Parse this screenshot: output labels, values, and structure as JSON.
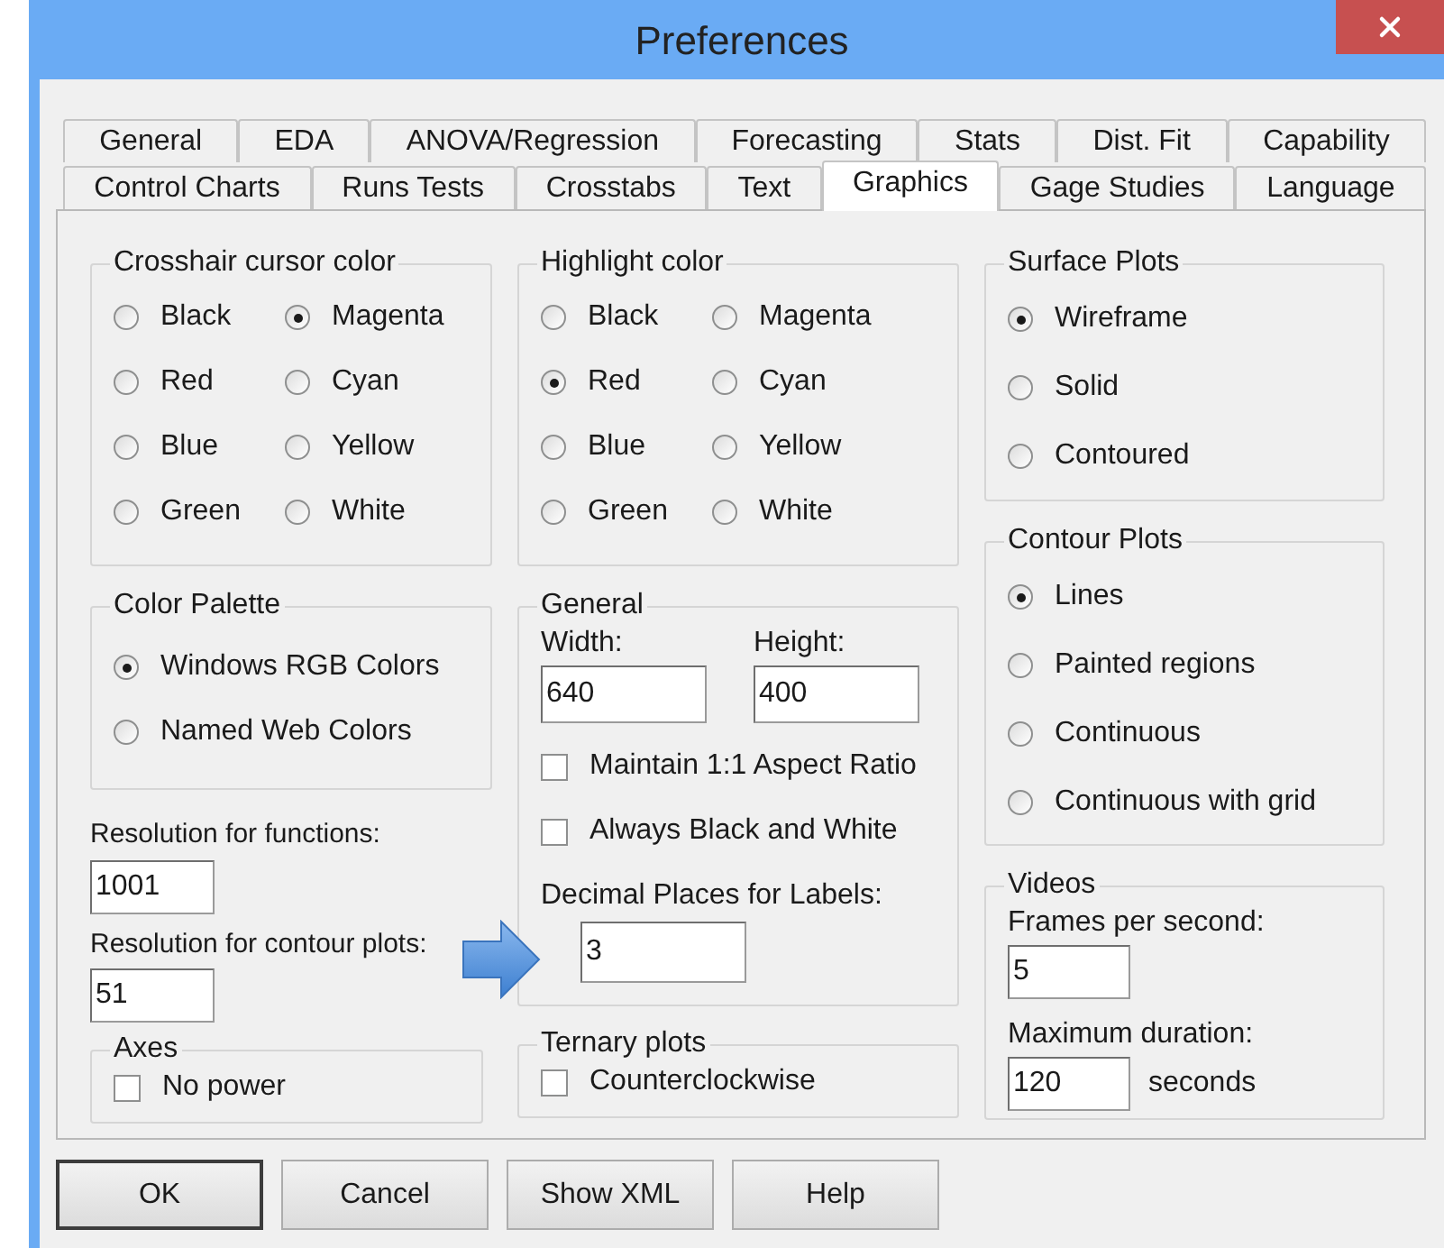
{
  "window": {
    "title": "Preferences"
  },
  "tab_rows": [
    {
      "tabs": [
        {
          "label": "General",
          "selected": false
        },
        {
          "label": "EDA",
          "selected": false
        },
        {
          "label": "ANOVA/Regression",
          "selected": false
        },
        {
          "label": "Forecasting",
          "selected": false
        },
        {
          "label": "Stats",
          "selected": false
        },
        {
          "label": "Dist. Fit",
          "selected": false
        },
        {
          "label": "Capability",
          "selected": false
        }
      ]
    },
    {
      "tabs": [
        {
          "label": "Control Charts",
          "selected": false
        },
        {
          "label": "Runs Tests",
          "selected": false
        },
        {
          "label": "Crosstabs",
          "selected": false
        },
        {
          "label": "Text",
          "selected": false
        },
        {
          "label": "Graphics",
          "selected": true
        },
        {
          "label": "Gage Studies",
          "selected": false
        },
        {
          "label": "Language",
          "selected": false
        }
      ]
    }
  ],
  "crosshair_cursor_color": {
    "title": "Crosshair cursor color",
    "options": [
      {
        "label": "Black",
        "selected": false
      },
      {
        "label": "Magenta",
        "selected": true
      },
      {
        "label": "Red",
        "selected": false
      },
      {
        "label": "Cyan",
        "selected": false
      },
      {
        "label": "Blue",
        "selected": false
      },
      {
        "label": "Yellow",
        "selected": false
      },
      {
        "label": "Green",
        "selected": false
      },
      {
        "label": "White",
        "selected": false
      }
    ]
  },
  "color_palette": {
    "title": "Color Palette",
    "options": [
      {
        "label": "Windows RGB Colors",
        "selected": true
      },
      {
        "label": "Named Web Colors",
        "selected": false
      }
    ]
  },
  "resolution_functions": {
    "label": "Resolution for functions:",
    "value": "1001"
  },
  "resolution_contour": {
    "label": "Resolution for contour plots:",
    "value": "51"
  },
  "axes": {
    "title": "Axes",
    "checkboxes": [
      {
        "label": "No power",
        "checked": false
      }
    ]
  },
  "highlight_color": {
    "title": "Highlight color",
    "options": [
      {
        "label": "Black",
        "selected": false
      },
      {
        "label": "Magenta",
        "selected": false
      },
      {
        "label": "Red",
        "selected": true
      },
      {
        "label": "Cyan",
        "selected": false
      },
      {
        "label": "Blue",
        "selected": false
      },
      {
        "label": "Yellow",
        "selected": false
      },
      {
        "label": "Green",
        "selected": false
      },
      {
        "label": "White",
        "selected": false
      }
    ]
  },
  "general": {
    "title": "General",
    "width": {
      "label": "Width:",
      "value": "640"
    },
    "height": {
      "label": "Height:",
      "value": "400"
    },
    "checkboxes": [
      {
        "label": "Maintain 1:1 Aspect Ratio",
        "checked": false
      },
      {
        "label": "Always Black and White",
        "checked": false
      }
    ],
    "decimal_places": {
      "label": "Decimal Places for Labels:",
      "value": "3"
    }
  },
  "ternary_plots": {
    "title": "Ternary plots",
    "checkboxes": [
      {
        "label": "Counterclockwise",
        "checked": false
      }
    ]
  },
  "surface_plots": {
    "title": "Surface Plots",
    "options": [
      {
        "label": "Wireframe",
        "selected": true
      },
      {
        "label": "Solid",
        "selected": false
      },
      {
        "label": "Contoured",
        "selected": false
      }
    ]
  },
  "contour_plots": {
    "title": "Contour Plots",
    "options": [
      {
        "label": "Lines",
        "selected": true
      },
      {
        "label": "Painted regions",
        "selected": false
      },
      {
        "label": "Continuous",
        "selected": false
      },
      {
        "label": "Continuous with grid",
        "selected": false
      }
    ]
  },
  "videos": {
    "title": "Videos",
    "frames": {
      "label": "Frames per second:",
      "value": "5"
    },
    "duration": {
      "label": "Maximum duration:",
      "value": "120",
      "unit": "seconds"
    }
  },
  "buttons": [
    {
      "label": "OK",
      "default": true
    },
    {
      "label": "Cancel",
      "default": false
    },
    {
      "label": "Show XML",
      "default": false
    },
    {
      "label": "Help",
      "default": false
    }
  ]
}
